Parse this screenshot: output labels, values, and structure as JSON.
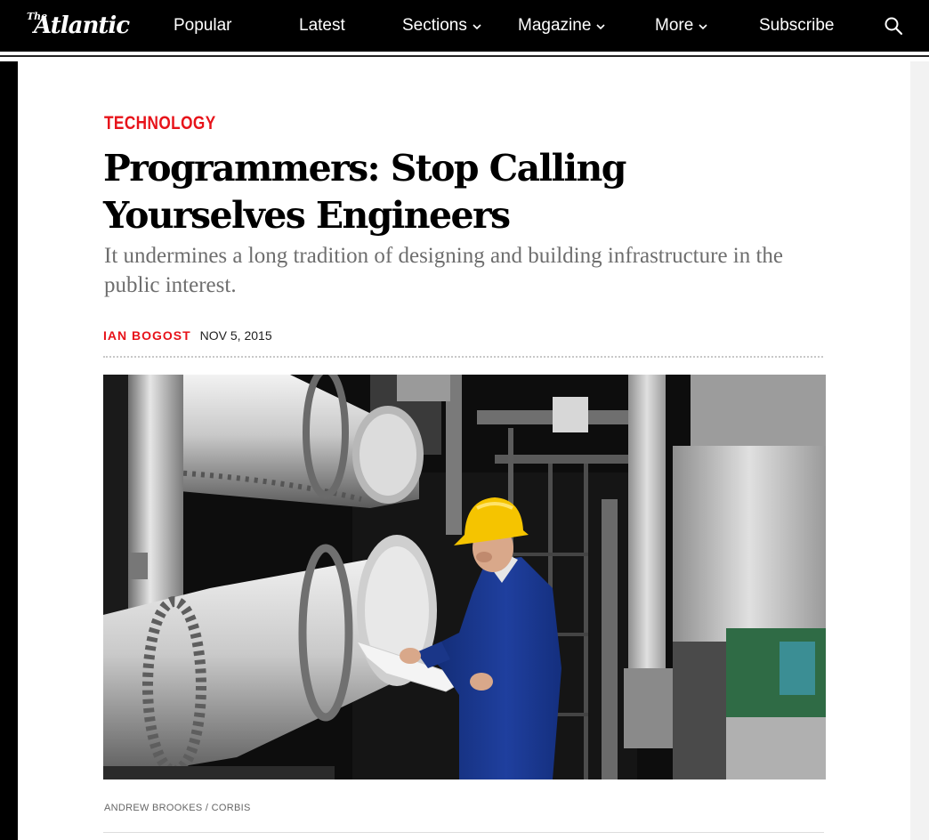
{
  "brand": {
    "the": "The",
    "name": "Atlantic"
  },
  "nav": {
    "items": [
      {
        "label": "Popular"
      },
      {
        "label": "Latest"
      },
      {
        "label": "Sections"
      },
      {
        "label": "Magazine"
      },
      {
        "label": "More"
      },
      {
        "label": "Subscribe"
      }
    ]
  },
  "article": {
    "section": "TECHNOLOGY",
    "title": "Programmers: Stop Calling Yourselves Engineers",
    "dek": "It undermines a long tradition of designing and building infrastructure in the public interest.",
    "author": "IAN BOGOST",
    "date": "NOV 5, 2015",
    "photo_credit": "ANDREW BROOKES / CORBIS"
  },
  "colors": {
    "accent": "#e7131a",
    "nav_bg": "#000000",
    "dek": "#6e6e6e",
    "worker_suit": "#1f3f9e",
    "hardhat": "#f5c400"
  },
  "icons": {
    "search": "search-icon",
    "chevron": "chevron-down-icon"
  }
}
